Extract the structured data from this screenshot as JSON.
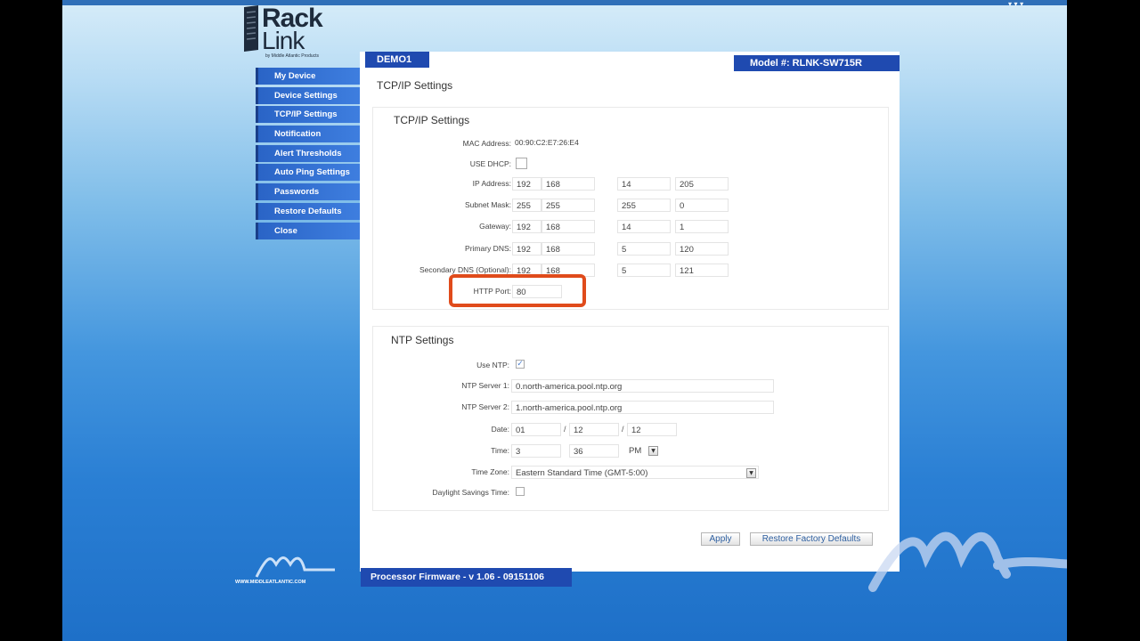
{
  "logo": {
    "line1": "Rack",
    "line2": "Link",
    "tagline": "by Middle Atlantic Products"
  },
  "sidebar": {
    "items": [
      {
        "label": "My Device"
      },
      {
        "label": "Device Settings"
      },
      {
        "label": "TCP/IP Settings"
      },
      {
        "label": "Notification"
      },
      {
        "label": "Alert Thresholds"
      },
      {
        "label": "Auto Ping Settings"
      },
      {
        "label": "Passwords"
      },
      {
        "label": "Restore Defaults"
      },
      {
        "label": "Close"
      }
    ]
  },
  "header": {
    "device_name": "DEMO1",
    "model": "Model #: RLNK-SW715R",
    "page_title": "TCP/IP Settings"
  },
  "tcpip": {
    "title": "TCP/IP Settings",
    "mac_label": "MAC Address:",
    "mac_value": "00:90:C2:E7:26:E4",
    "dhcp_label": "USE DHCP:",
    "rows": [
      {
        "label": "IP Address:",
        "values": [
          "192",
          "168",
          "14",
          "205"
        ]
      },
      {
        "label": "Subnet Mask:",
        "values": [
          "255",
          "255",
          "255",
          "0"
        ]
      },
      {
        "label": "Gateway:",
        "values": [
          "192",
          "168",
          "14",
          "1"
        ]
      },
      {
        "label": "Primary DNS:",
        "values": [
          "192",
          "168",
          "5",
          "120"
        ]
      },
      {
        "label": "Secondary DNS (Optional):",
        "values": [
          "192",
          "168",
          "5",
          "121"
        ]
      }
    ],
    "http_port_label": "HTTP Port:",
    "http_port_value": "80"
  },
  "ntp": {
    "title": "NTP Settings",
    "use_ntp_label": "Use NTP:",
    "use_ntp_checked": "✓",
    "server1_label": "NTP Server 1:",
    "server1_value": "0.north-america.pool.ntp.org",
    "server2_label": "NTP Server 2:",
    "server2_value": "1.north-america.pool.ntp.org",
    "date_label": "Date:",
    "date_month": "01",
    "date_day": "12",
    "date_year": "12",
    "date_sep": "/",
    "time_label": "Time:",
    "time_hour": "3",
    "time_minute": "36",
    "time_ampm": "PM",
    "timezone_label": "Time Zone:",
    "timezone_value": "Eastern Standard Time (GMT-5:00)",
    "dst_label": "Daylight Savings Time:"
  },
  "buttons": {
    "apply": "Apply",
    "restore": "Restore Factory Defaults"
  },
  "footer": {
    "firmware": "Processor Firmware - v 1.06 - 09151106",
    "url": "WWW.MIDDLEATLANTIC.COM"
  },
  "colors": {
    "nav_blue": "#2a64c6",
    "header_blue": "#1f4ab0",
    "highlight": "#e04b1b"
  },
  "icons": {
    "dropdown": "chevron-down-icon",
    "checkbox": "checkbox-icon"
  }
}
